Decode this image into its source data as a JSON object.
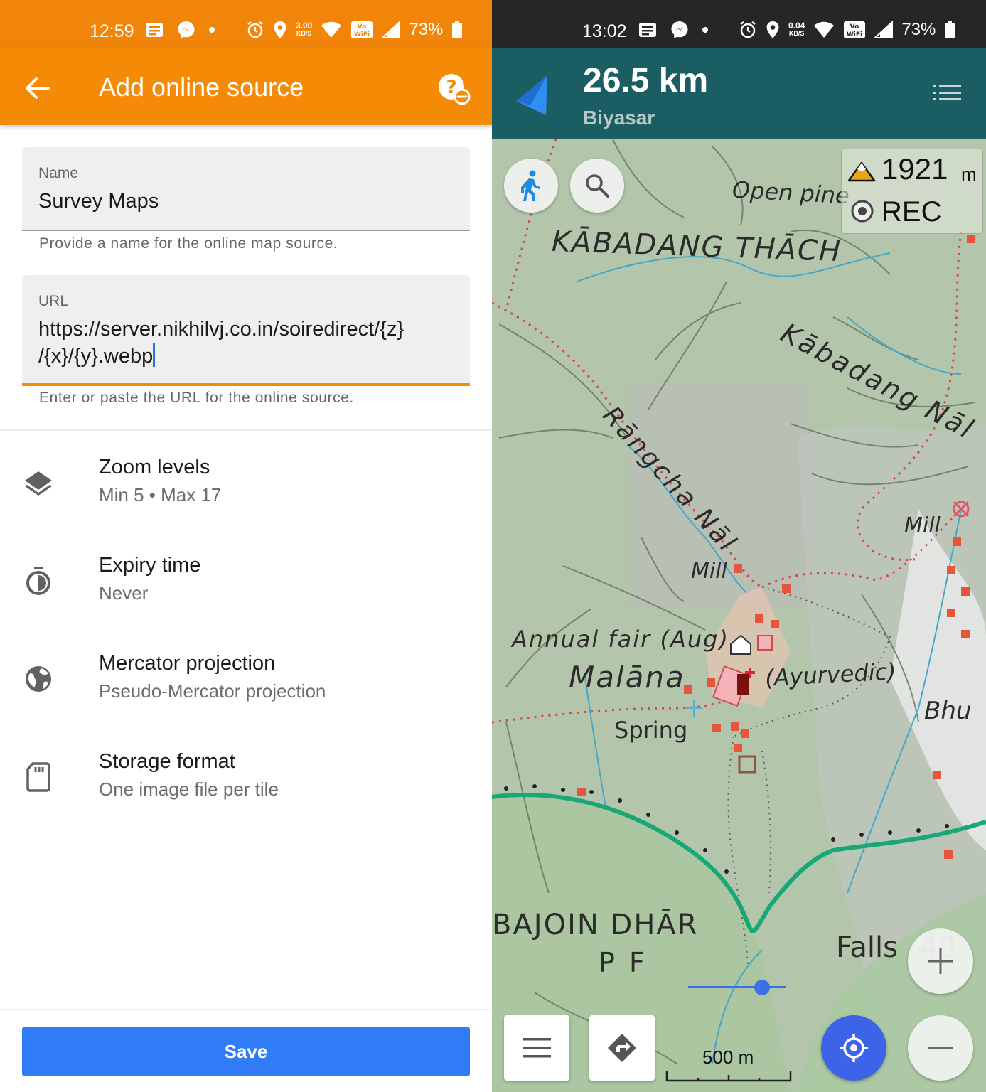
{
  "left_screen": {
    "status_bar": {
      "time": "12:59",
      "speed_value": "3.00",
      "speed_unit": "KB/S",
      "battery": "73%",
      "background_color": "#f0850a"
    },
    "app_bar": {
      "title": "Add online source",
      "back_icon": "arrow-left-icon",
      "help_icon": "help-link-icon",
      "color": "#f58a07"
    },
    "name_field": {
      "label": "Name",
      "value": "Survey Maps",
      "helper": "Provide a name for the online map source."
    },
    "url_field": {
      "label": "URL",
      "value_line1": "https://server.nikhilvj.co.in/soiredirect/{z}",
      "value_line2": "/{x}/{y}.webp",
      "helper": "Enter or paste the URL for the online source."
    },
    "settings": [
      {
        "icon": "layers-icon",
        "title": "Zoom levels",
        "subtitle": "Min 5 • Max 17"
      },
      {
        "icon": "timer-icon",
        "title": "Expiry time",
        "subtitle": "Never"
      },
      {
        "icon": "globe-icon",
        "title": "Mercator projection",
        "subtitle": "Pseudo-Mercator projection"
      },
      {
        "icon": "sd-card-icon",
        "title": "Storage format",
        "subtitle": "One image file per tile"
      }
    ],
    "save_button": {
      "label": "Save",
      "color": "#2f7cf6"
    }
  },
  "right_screen": {
    "status_bar": {
      "time": "13:02",
      "speed_value": "0.04",
      "speed_unit": "KB/S",
      "battery": "73%",
      "background_color": "#262626"
    },
    "navigation": {
      "distance": "26.5 km",
      "destination": "Biyasar",
      "bar_color": "#1a5d62"
    },
    "altitude": {
      "value": "1921",
      "unit": "m"
    },
    "recording_label": "REC",
    "map_labels": {
      "open_pine": "Open pine",
      "kabadang_thach": "KĀBADANG THĀCH",
      "kabadang_nal": "Kābadang Nāl",
      "rangcha_nal": "Rāngcha Nāl",
      "mill_1": "Mill",
      "mill_2": "Mill",
      "annual_fair": "Annual fair (Aug)",
      "malana": "Malāna",
      "ayurvedic": "(Ayurvedic)",
      "spring": "Spring",
      "bhu": "Bhu",
      "bajoin_dhar": "BAJOIN DHĀR",
      "pf": "P F",
      "falls": "Falls",
      "falls_number": "40"
    },
    "scale": "500 m",
    "zoom_slider_level": 0.75,
    "buttons": {
      "walk": "walk-icon",
      "search": "search-icon",
      "menu": "menu-icon",
      "directions": "directions-icon",
      "my_location": "my-location-icon",
      "zoom_in": "plus-icon",
      "zoom_out": "minus-icon"
    }
  }
}
